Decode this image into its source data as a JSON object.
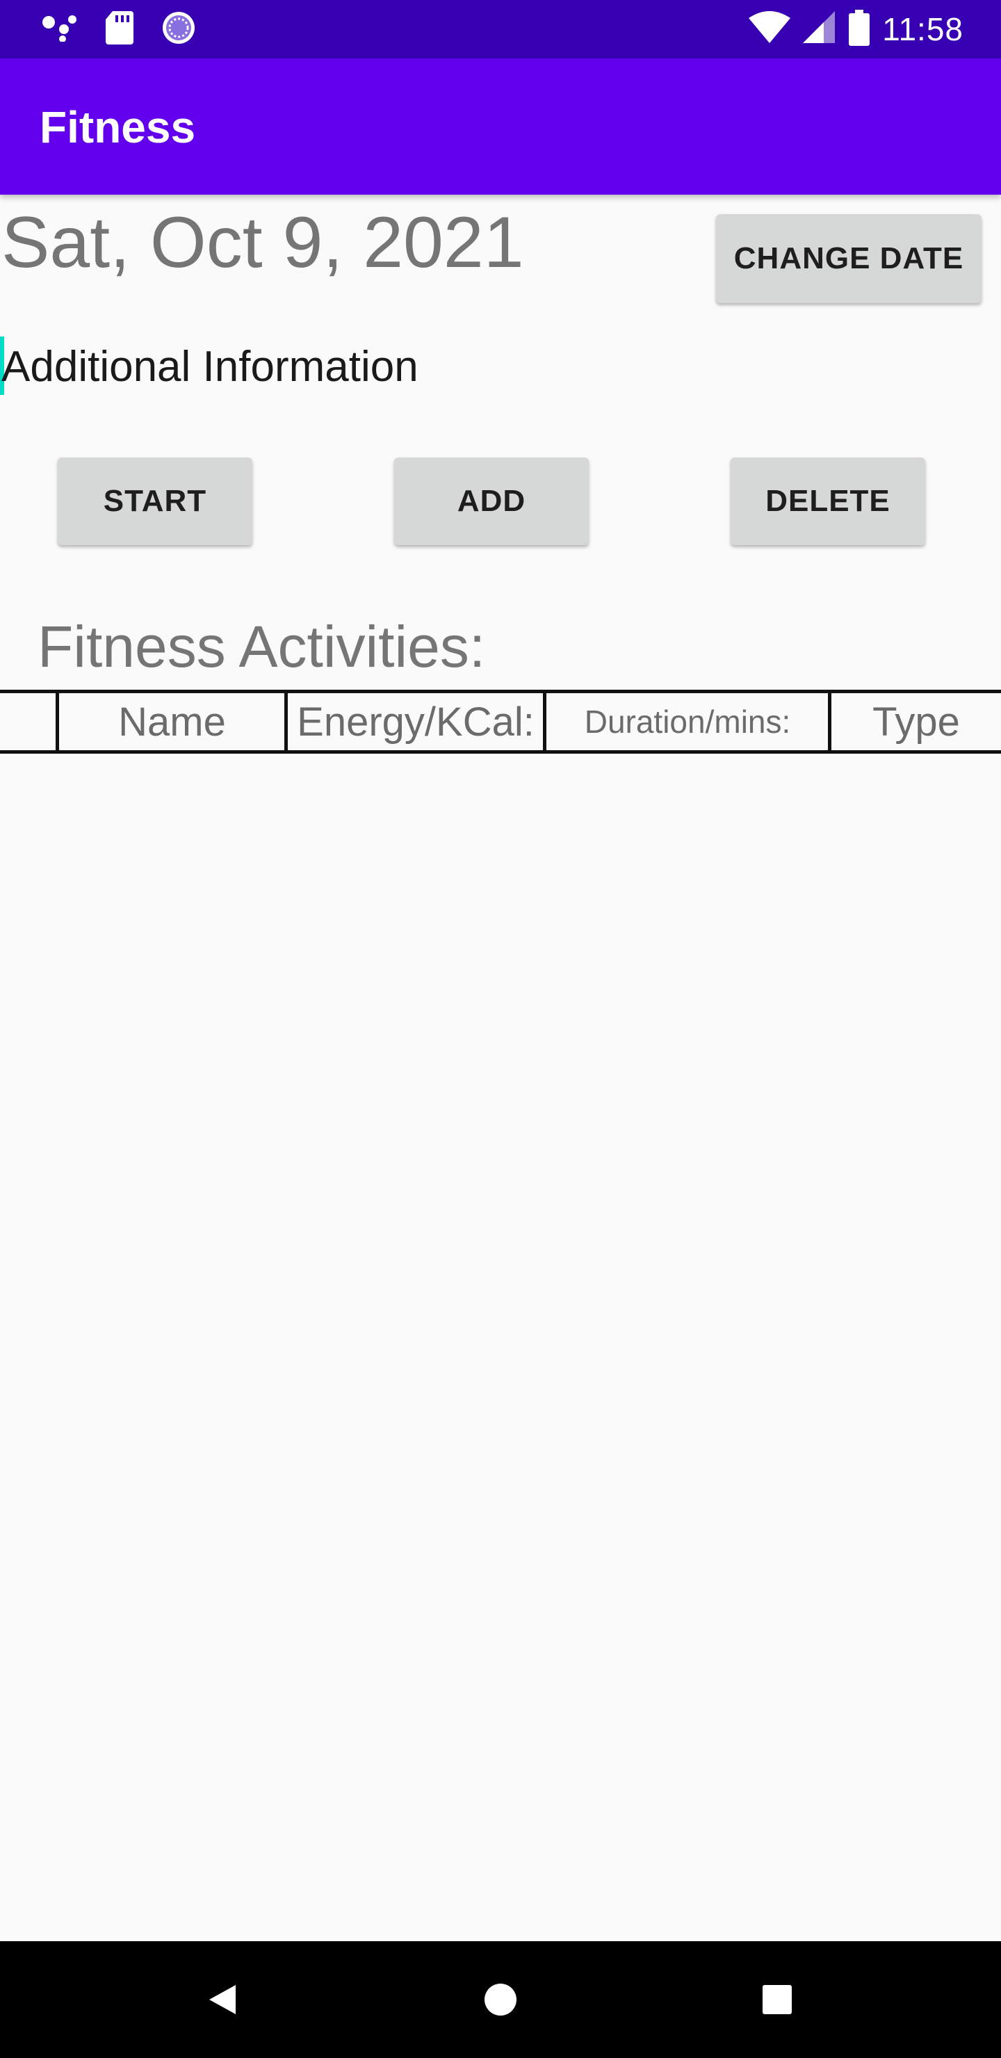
{
  "status_bar": {
    "time": "11:58",
    "left_icons": [
      "assistant-dots-icon",
      "sd-card-icon",
      "sync-circle-icon"
    ],
    "right_icons": [
      "wifi-icon",
      "cell-signal-icon",
      "battery-icon"
    ]
  },
  "app_bar": {
    "title": "Fitness"
  },
  "date": {
    "value": "Sat, Oct 9, 2021",
    "change_button_label": "CHANGE DATE"
  },
  "additional_info": {
    "value": "Additional Information"
  },
  "actions": {
    "start_label": "START",
    "add_label": "ADD",
    "delete_label": "DELETE"
  },
  "activities": {
    "title": "Fitness Activities:",
    "columns": [
      "",
      "Name",
      "Energy/KCal:",
      "Duration/mins:",
      "Type"
    ],
    "rows": []
  },
  "nav_bar": {
    "icons": [
      "back-icon",
      "home-icon",
      "recents-icon"
    ]
  },
  "colors": {
    "status_bar": "#3700b3",
    "app_bar": "#6200ee",
    "accent": "#03dac5",
    "button": "#d6d7d7",
    "background": "#fafafa"
  }
}
